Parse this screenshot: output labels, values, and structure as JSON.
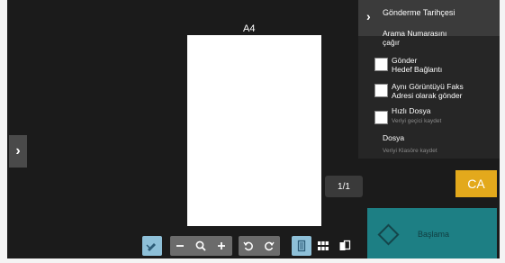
{
  "preview": {
    "paper_size": "A4",
    "page_counter": "1/1"
  },
  "panel": {
    "header_title": "Gönderme Tarihçesi",
    "call_number": [
      "Arama Numarasını",
      "çağır"
    ],
    "options": [
      {
        "lines": [
          "Gönder",
          "Hedef Bağlantı"
        ],
        "sub": ""
      },
      {
        "lines": [
          "Aynı Görüntüyü Faks",
          "Adresi olarak gönder"
        ],
        "sub": ""
      },
      {
        "lines": [
          "Hızlı Dosya"
        ],
        "sub": "Veriyi geçici kaydet"
      }
    ],
    "file": {
      "label": "Dosya",
      "sub": "Veriyi Klasöre kaydet"
    }
  },
  "actions": {
    "ca": "CA",
    "start": "Başlama"
  },
  "colors": {
    "ca_bg": "#e3a91c",
    "start_bg": "#1d7f84",
    "toolbar_accent": "#8ec0d8"
  },
  "icons": [
    "chevron-right-icon",
    "edit-icon",
    "zoom-out-icon",
    "magnifier-icon",
    "zoom-in-icon",
    "rotate-left-icon",
    "rotate-right-icon",
    "single-page-icon",
    "grid-view-icon",
    "copy-pages-icon",
    "diamond-start-icon"
  ]
}
